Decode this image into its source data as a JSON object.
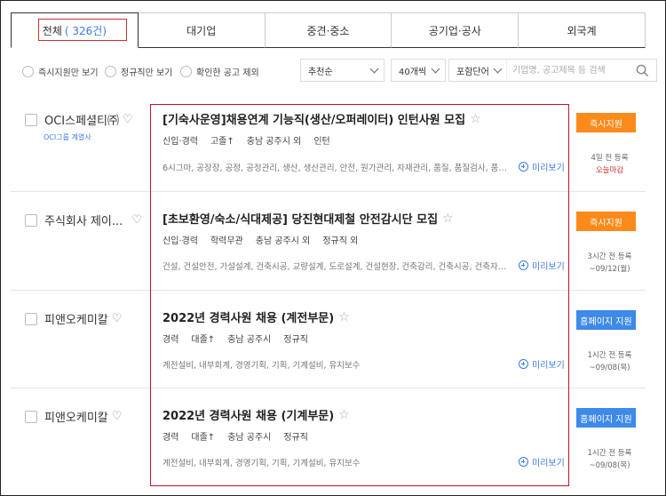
{
  "tabs": [
    {
      "label": "전체",
      "count": "( 326건)"
    },
    {
      "label": "대기업"
    },
    {
      "label": "중견·중소"
    },
    {
      "label": "공기업·공사"
    },
    {
      "label": "외국계"
    }
  ],
  "filters": {
    "instant_apply": "즉시지원만 보기",
    "regular_only": "정규직만 보기",
    "exclude_seen": "확인한 공고 제외",
    "sort": "추천순",
    "per_page": "40개씩",
    "search_scope": "포함단어",
    "search_placeholder": "기업명, 공고제목 등 검색"
  },
  "jobs": [
    {
      "company": "OCI스페셜티㈜",
      "affiliate": "OCI그룹 계열사",
      "title": "[기숙사운영]채용연계 기능직(생산/오퍼레이터) 인턴사원 모집",
      "meta": [
        "신입·경력",
        "고졸↑",
        "충남 공주시 외",
        "인턴"
      ],
      "keywords": "6시그마, 공장장, 공정, 공정관리, 생산, 생산관리, 안전, 원가관리, 자재관리, 품질, 품질검사, 품질관리",
      "preview": "미리보기",
      "apply": "즉시지원",
      "apply_style": "orange",
      "posted": "4일 전 등록",
      "deadline": "오늘마감",
      "deadline_red": true
    },
    {
      "company": "주식회사 제이...",
      "affiliate": "",
      "title": "[초보환영/숙소/식대제공] 당진현대제철 안전감시단 모집",
      "meta": [
        "신입·경력",
        "학력무관",
        "충남 공주시 외",
        "정규직 외"
      ],
      "keywords": "건설, 건설안전, 가설설계, 건축시공, 교량설계, 도로설계, 건설현장, 건축감리, 건축시공, 건축자재, ...",
      "preview": "미리보기",
      "apply": "즉시지원",
      "apply_style": "orange",
      "posted": "3시간 전 등록",
      "deadline": "~09/12(월)",
      "deadline_red": false
    },
    {
      "company": "피앤오케미칼",
      "affiliate": "",
      "title": "2022년 경력사원 채용 (계전부문)",
      "meta": [
        "경력",
        "대졸↑",
        "충남 공주시",
        "정규직"
      ],
      "keywords": "계전설비, 내부회계, 경영기획, 기획, 기계설비, 유지보수",
      "preview": "미리보기",
      "apply": "홈페이지 지원",
      "apply_style": "blue",
      "posted": "1시간 전 등록",
      "deadline": "~09/08(목)",
      "deadline_red": false
    },
    {
      "company": "피앤오케미칼",
      "affiliate": "",
      "title": "2022년 경력사원 채용 (기계부문)",
      "meta": [
        "경력",
        "대졸↑",
        "충남 공주시",
        "정규직"
      ],
      "keywords": "계전설비, 내부회계, 경영기획, 기획, 기계설비, 유지보수",
      "preview": "미리보기",
      "apply": "홈페이지 지원",
      "apply_style": "blue",
      "posted": "1시간 전 등록",
      "deadline": "~09/08(목)",
      "deadline_red": false
    }
  ]
}
